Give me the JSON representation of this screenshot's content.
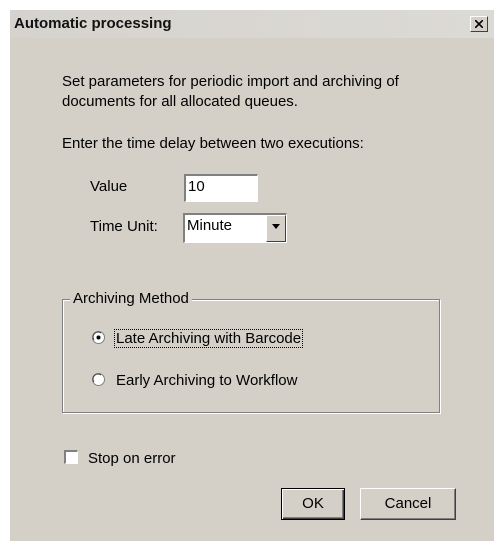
{
  "window": {
    "title": "Automatic processing",
    "close_label": "close"
  },
  "intro": {
    "line1": "Set parameters for periodic import and archiving of",
    "line2": "documents for all allocated queues."
  },
  "delay_prompt": "Enter the time delay between two executions:",
  "value_field": {
    "label": "Value",
    "value": "10"
  },
  "time_unit": {
    "label": "Time Unit:",
    "selected": "Minute"
  },
  "archiving_method": {
    "legend": "Archiving Method",
    "options": [
      {
        "label": "Late Archiving with Barcode",
        "selected": true
      },
      {
        "label": "Early Archiving to Workflow",
        "selected": false
      }
    ]
  },
  "stop_on_error": {
    "label": "Stop on error",
    "checked": false
  },
  "buttons": {
    "ok": "OK",
    "cancel": "Cancel"
  }
}
